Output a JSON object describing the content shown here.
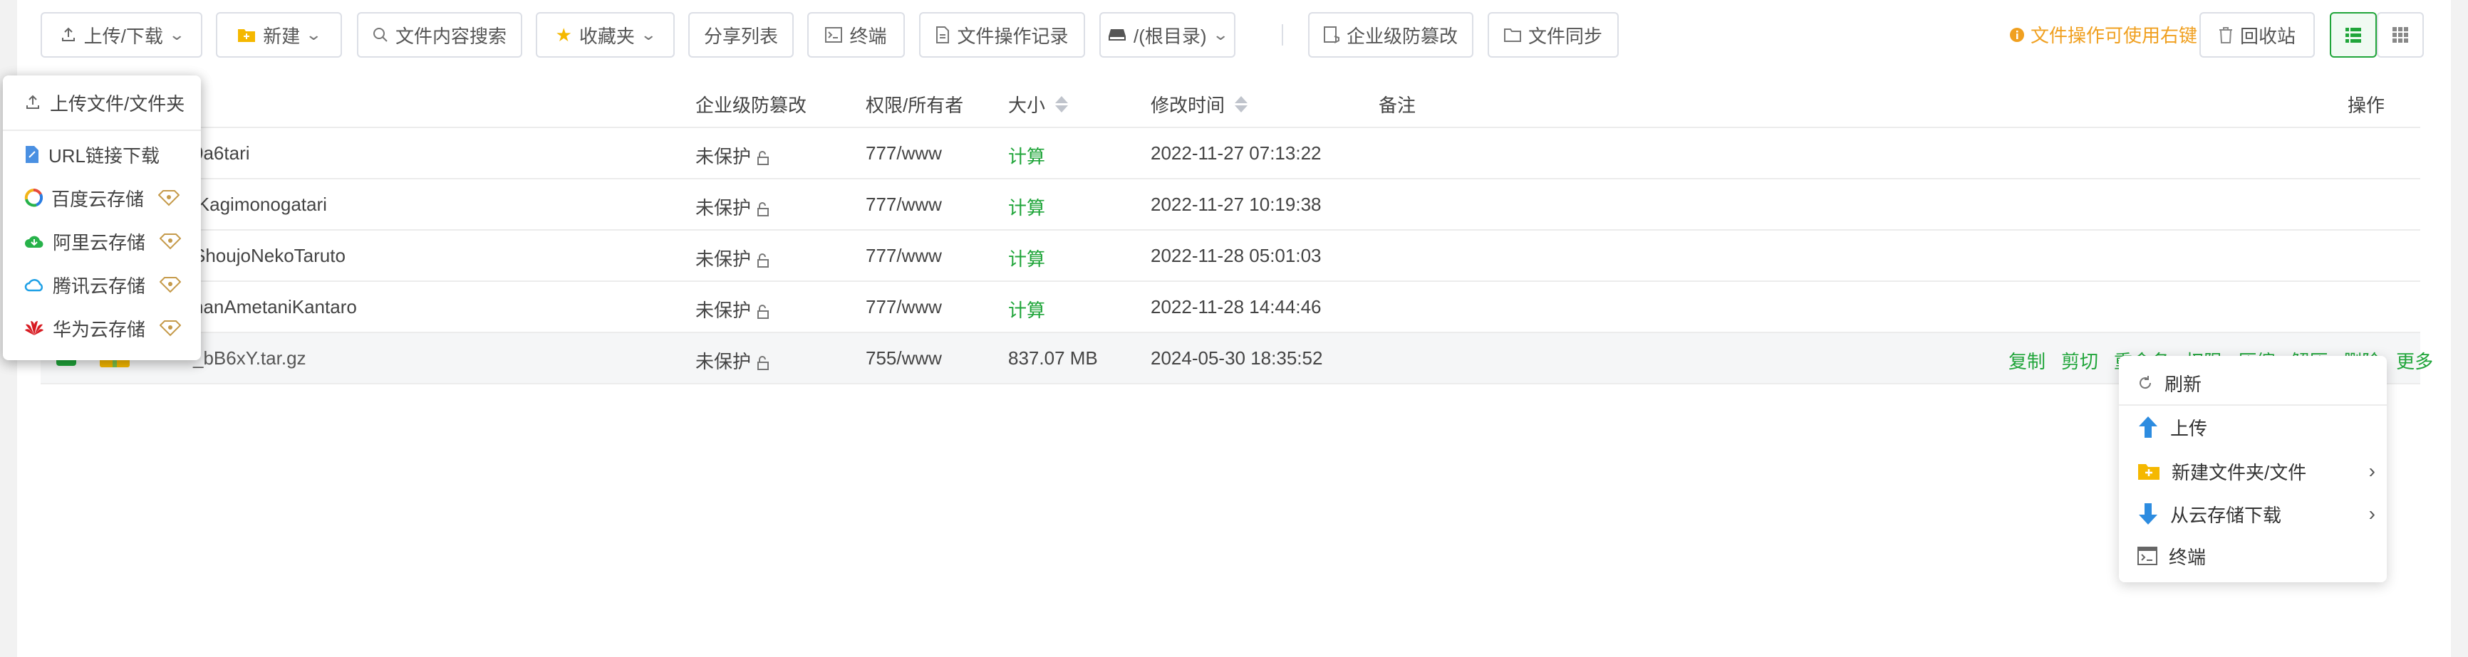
{
  "toolbar": {
    "upload_download": "上传/下载",
    "new": "新建",
    "content_search": "文件内容搜索",
    "favorites": "收藏夹",
    "share_list": "分享列表",
    "terminal": "终端",
    "op_log": "文件操作记录",
    "path": "/(根目录)",
    "tamper_proof": "企业级防篡改",
    "file_sync": "文件同步",
    "hint": "文件操作可使用右键",
    "recycle_bin": "回收站"
  },
  "table": {
    "headers": {
      "tamper": "企业级防篡改",
      "perm": "权限/所有者",
      "size": "大小",
      "mtime": "修改时间",
      "remark": "备注",
      "ops": "操作"
    },
    "rows": [
      {
        "name": "9a6tari",
        "protect": "未保护",
        "perm": "777/www",
        "size": "计算",
        "mtime": "2022-11-27 07:13:22"
      },
      {
        "name": "iKagimonogatari",
        "protect": "未保护",
        "perm": "777/www",
        "size": "计算",
        "mtime": "2022-11-27 10:19:38"
      },
      {
        "name": "ShoujoNekoTaruto",
        "protect": "未保护",
        "perm": "777/www",
        "size": "计算",
        "mtime": "2022-11-28 05:01:03"
      },
      {
        "name": "nanAmetaniKantaro",
        "protect": "未保护",
        "perm": "777/www",
        "size": "计算",
        "mtime": "2022-11-28 14:44:46"
      },
      {
        "name": "_bB6xY.tar.gz",
        "protect": "未保护",
        "perm": "755/www",
        "size": "837.07 MB",
        "mtime": "2024-05-30 18:35:52"
      }
    ],
    "row_ops": [
      "复制",
      "剪切",
      "重命名",
      "权限",
      "压缩",
      "解压",
      "删除",
      "更多"
    ]
  },
  "upload_menu": {
    "items": [
      {
        "label": "上传文件/文件夹"
      },
      {
        "label": "URL链接下载"
      },
      {
        "label": "百度云存储"
      },
      {
        "label": "阿里云存储"
      },
      {
        "label": "腾讯云存储"
      },
      {
        "label": "华为云存储"
      }
    ]
  },
  "context_menu": {
    "refresh": "刷新",
    "upload": "上传",
    "new_folder_file": "新建文件夹/文件",
    "cloud_download": "从云存储下载",
    "terminal": "终端"
  },
  "colors": {
    "accent": "#20a53a",
    "warning": "#f0a020"
  }
}
